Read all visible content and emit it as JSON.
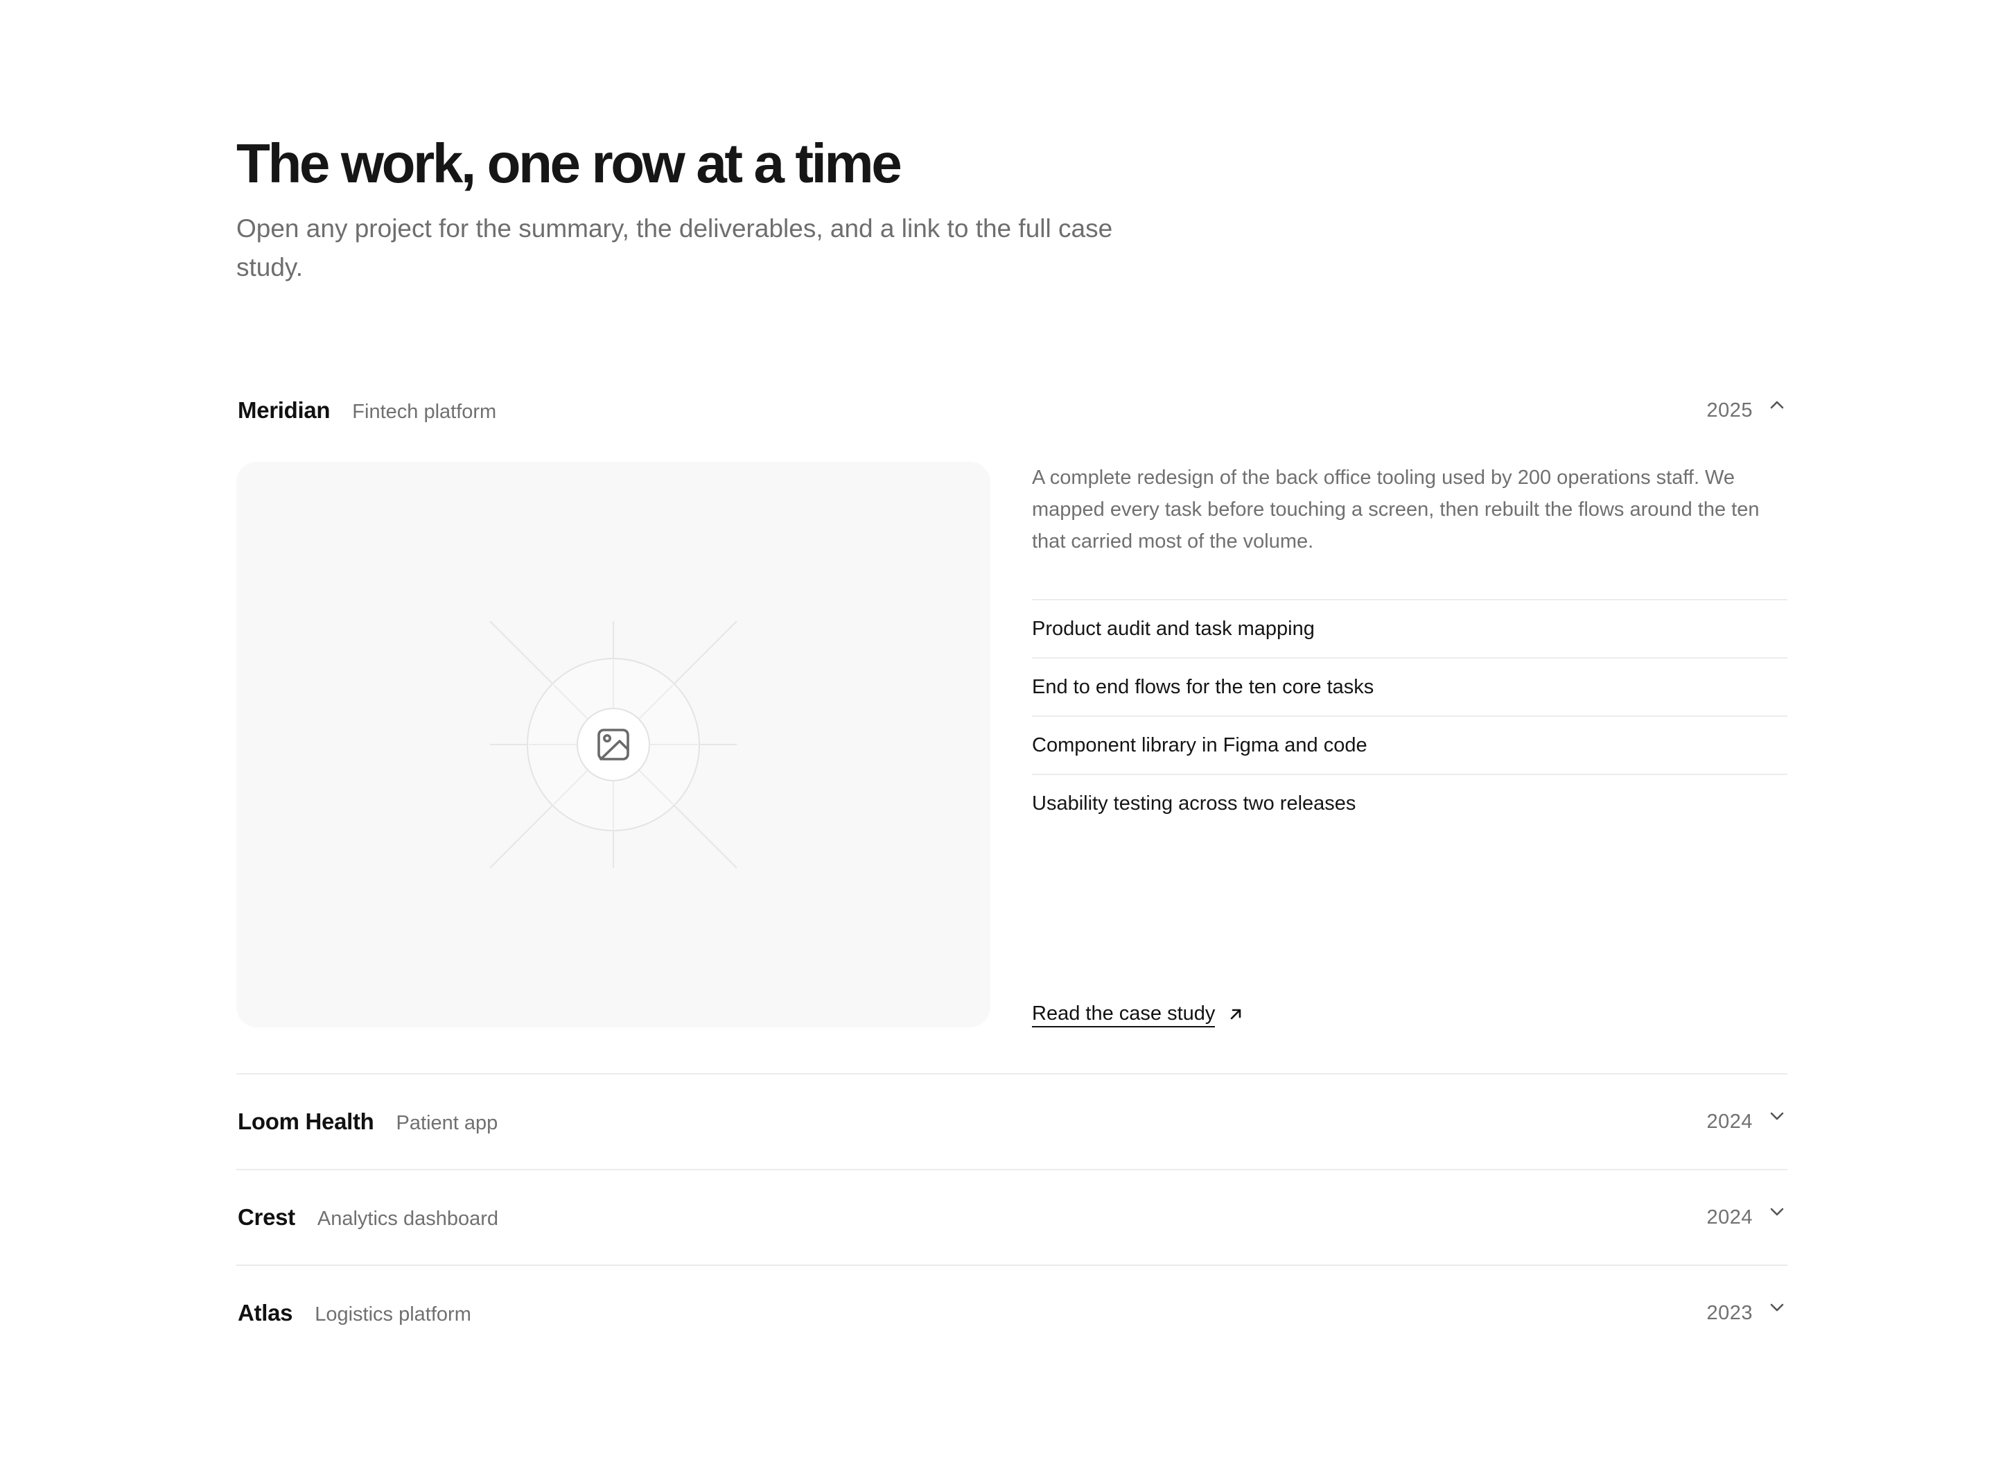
{
  "header": {
    "title": "The work, one row at a time",
    "subtitle": "Open any project for the summary, the deliverables, and a link to the full case study."
  },
  "projects": [
    {
      "name": "Meridian",
      "tag": "Fintech platform",
      "year": "2025",
      "expanded": true,
      "chevron": "chevron-up-icon",
      "media_icon": "image-icon",
      "summary": "A complete redesign of the back office tooling used by 200 operations staff. We mapped every task before touching a screen, then rebuilt the flows around the ten that carried most of the volume.",
      "deliverables": [
        "Product audit and task mapping",
        "End to end flows for the ten core tasks",
        "Component library in Figma and code",
        "Usability testing across two releases"
      ],
      "link_label": "Read the case study",
      "link_icon": "arrow-up-right-icon"
    },
    {
      "name": "Loom Health",
      "tag": "Patient app",
      "year": "2024",
      "expanded": false,
      "chevron": "chevron-down-icon"
    },
    {
      "name": "Crest",
      "tag": "Analytics dashboard",
      "year": "2024",
      "expanded": false,
      "chevron": "chevron-down-icon"
    },
    {
      "name": "Atlas",
      "tag": "Logistics platform",
      "year": "2023",
      "expanded": false,
      "chevron": "chevron-down-icon"
    }
  ],
  "colors": {
    "text": "#111111",
    "muted": "#707070",
    "divider": "#ebebeb",
    "media_bg": "#f8f8f8"
  }
}
